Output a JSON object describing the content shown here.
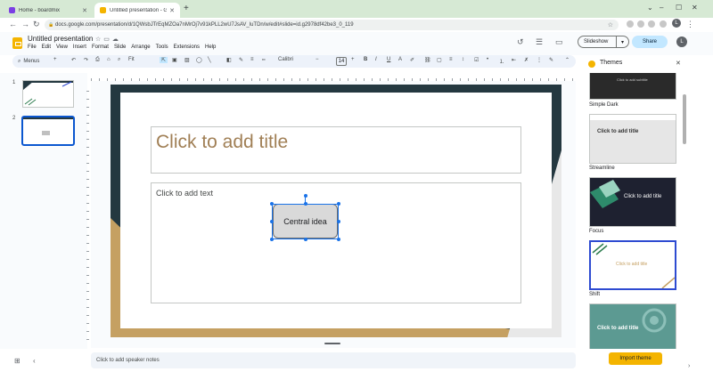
{
  "browser": {
    "tabs": [
      {
        "title": "Home - boardmix",
        "favicon_color": "#7b3fe4"
      },
      {
        "title": "Untitled presentation - Goog",
        "favicon_color": "#f4b400"
      }
    ],
    "url": "docs.google.com/presentation/d/1QWsbJTrEqMZOa7nMrOj7v91kPLL2wU7JsAV_luTDn/w/edit#slide=id.g2978df42be3_0_119",
    "profile_initial": "L"
  },
  "app": {
    "title": "Untitled presentation",
    "menu": [
      "File",
      "Edit",
      "View",
      "Insert",
      "Format",
      "Slide",
      "Arrange",
      "Tools",
      "Extensions",
      "Help"
    ],
    "slideshow_label": "Slideshow",
    "share_label": "Share",
    "avatar_initial": "L"
  },
  "toolbar": {
    "menus_label": "Menus",
    "zoom": "Fit",
    "font": "Calibri",
    "font_size": "14"
  },
  "filmstrip": {
    "slides": [
      {
        "number": "1"
      },
      {
        "number": "2"
      }
    ]
  },
  "slide": {
    "title_placeholder": "Click to add title",
    "body_placeholder": "Click to add text",
    "shape_text": "Central idea"
  },
  "notes": {
    "placeholder": "Click to add speaker notes"
  },
  "themes_panel": {
    "title": "Themes",
    "themes": [
      {
        "name": "Simple Dark",
        "preview_title": "",
        "preview_sub": "Click to add subtitle",
        "bg": "#2a2a2a"
      },
      {
        "name": "Streamline",
        "preview_title": "Click to add title",
        "bg": "#e6e6e6"
      },
      {
        "name": "Focus",
        "preview_title": "Click to add title",
        "bg": "#1e2130"
      },
      {
        "name": "Shift",
        "preview_title": "Click to add title",
        "bg": "#ffffff"
      },
      {
        "name": "",
        "preview_title": "Click to add title",
        "bg": "#5c9a92"
      }
    ],
    "import_label": "Import theme"
  },
  "colors": {
    "accent": "#0b57d0",
    "slide_dark": "#243840",
    "slide_tan": "#c5a062",
    "title_text": "#a07f55"
  }
}
